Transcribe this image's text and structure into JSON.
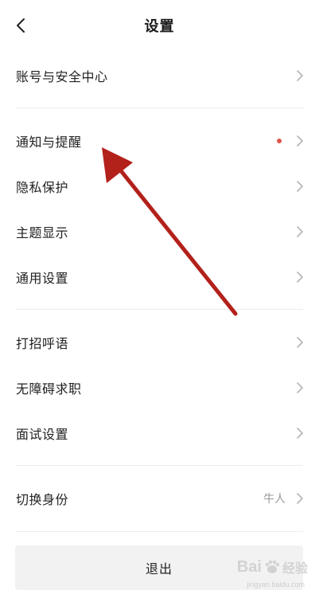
{
  "header": {
    "title": "设置"
  },
  "items": [
    {
      "label": "账号与安全中心"
    },
    {
      "label": "通知与提醒"
    },
    {
      "label": "隐私保护"
    },
    {
      "label": "主题显示"
    },
    {
      "label": "通用设置"
    },
    {
      "label": "打招呼语"
    },
    {
      "label": "无障碍求职"
    },
    {
      "label": "面试设置"
    },
    {
      "label": "切换身份",
      "value": "牛人"
    }
  ],
  "logout_label": "退出",
  "colors": {
    "notification_dot": "#e0544b",
    "annotation_arrow": "#b3211b",
    "logout_bg": "#f2f2f2"
  },
  "watermark": {
    "brand": "Bai",
    "brand_cn": "经验",
    "url": "jingyan.baidu.com"
  }
}
